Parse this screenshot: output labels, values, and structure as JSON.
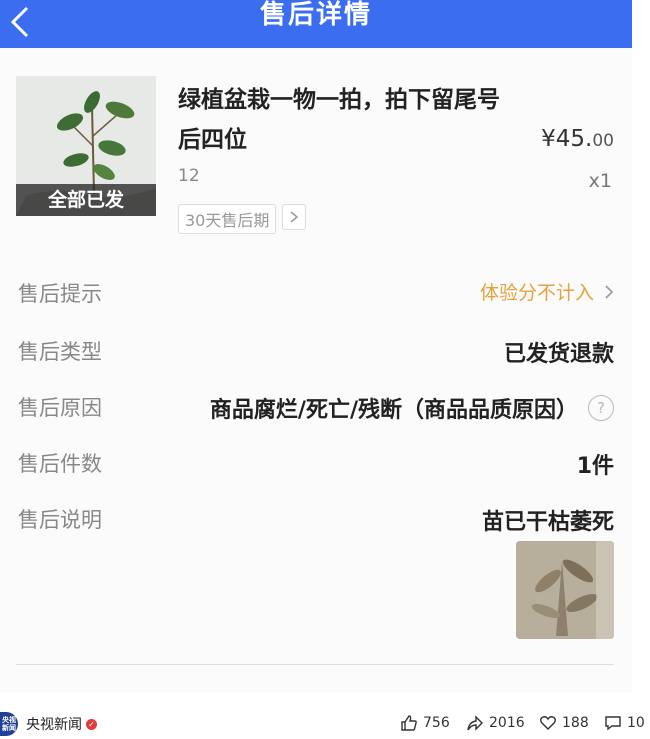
{
  "header": {
    "title": "售后详情"
  },
  "product": {
    "title": "绿植盆栽一物一拍，拍下留尾号后四位",
    "price_main": "¥45.",
    "price_cents": "00",
    "spec": "12",
    "quantity": "x1",
    "badge": "全部已发",
    "tag": "30天售后期"
  },
  "rows": [
    {
      "label": "售后提示",
      "value": "体验分不计入"
    },
    {
      "label": "售后类型",
      "value": "已发货退款"
    },
    {
      "label": "售后原因",
      "value": "商品腐烂/死亡/残断（商品品质原因）"
    },
    {
      "label": "售后件数",
      "value": "1件"
    },
    {
      "label": "售后说明",
      "value": "苗已干枯萎死"
    }
  ],
  "footer": {
    "channel": "央视新闻",
    "logo_text": "央视新闻",
    "likes": "756",
    "shares": "2016",
    "favorites": "188",
    "comments": "10"
  },
  "colors": {
    "topbar": "#3a6df0",
    "hint": "#e5a33c"
  }
}
